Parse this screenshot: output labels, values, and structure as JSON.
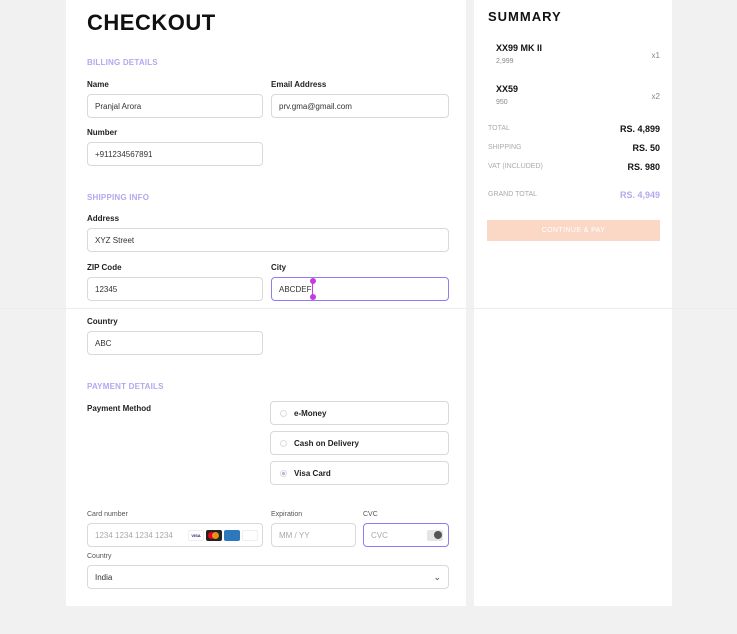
{
  "checkout": {
    "title": "CHECKOUT",
    "billing": {
      "section_label": "BILLING DETAILS",
      "name_label": "Name",
      "name_value": "Pranjal Arora",
      "email_label": "Email Address",
      "email_value": "prv.gma@gmail.com",
      "number_label": "Number",
      "number_value": "+911234567891"
    },
    "shipping": {
      "section_label": "SHIPPING INFO",
      "address_label": "Address",
      "address_value": "XYZ Street",
      "zip_label": "ZIP Code",
      "zip_value": "12345",
      "city_label": "City",
      "city_value": "ABCDEF",
      "country_label": "Country",
      "country_value": "ABC"
    },
    "payment": {
      "section_label": "PAYMENT DETAILS",
      "method_label": "Payment Method",
      "options": [
        "e-Money",
        "Cash on Delivery",
        "Visa Card"
      ],
      "selected": "Visa Card",
      "card_number_label": "Card number",
      "card_number_placeholder": "1234 1234 1234 1234",
      "card_brands": [
        "VISA",
        "mastercard",
        "AMEX",
        "DISCOVER"
      ],
      "expiration_label": "Expiration",
      "expiration_placeholder": "MM / YY",
      "cvc_label": "CVC",
      "cvc_placeholder": "CVC",
      "country_label": "Country",
      "country_value": "India"
    }
  },
  "summary": {
    "title": "SUMMARY",
    "items": [
      {
        "name": "XX99 MK II",
        "price": "2,999",
        "qty": "x1"
      },
      {
        "name": "XX59",
        "price": "950",
        "qty": "x2"
      }
    ],
    "total_label": "TOTAL",
    "total_value": "RS. 4,899",
    "shipping_label": "SHIPPING",
    "shipping_value": "RS. 50",
    "vat_label": "VAT (INCLUDED)",
    "vat_value": "RS. 980",
    "grand_total_label": "GRAND TOTAL",
    "grand_total_value": "RS. 4,949",
    "pay_button": "CONTINUE & PAY"
  },
  "colors": {
    "accent": "#b3a8ef",
    "button": "#fbd7c6",
    "background": "#f1f1f1",
    "caret": "#c73adf"
  }
}
